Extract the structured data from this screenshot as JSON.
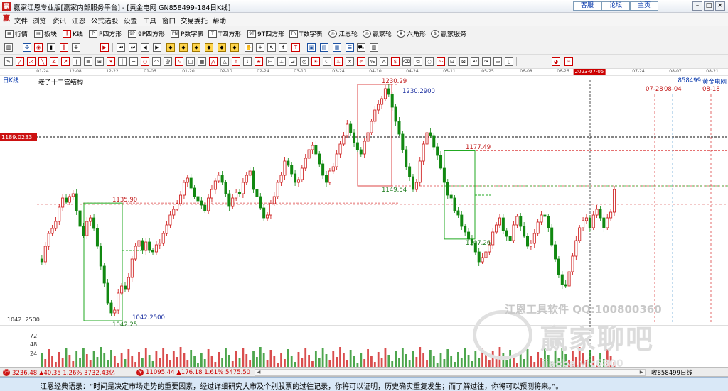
{
  "window": {
    "title": "赢家江恩专业版[赢家内部服务平台] - [黄金电网  GN858499-184日K线]",
    "links": [
      "客服",
      "论坛",
      "主页"
    ]
  },
  "menu": [
    "文件",
    "浏览",
    "资讯",
    "江恩",
    "公式选股",
    "设置",
    "工具",
    "窗口",
    "交易委托",
    "帮助"
  ],
  "toolbar1": [
    {
      "icon": "grid-icon",
      "label": "行情"
    },
    {
      "icon": "blocks-icon",
      "label": "板块"
    },
    {
      "icon": "candles-icon",
      "label": "K线"
    },
    {
      "icon": "p-square-icon",
      "label": "P四方形"
    },
    {
      "icon": "9p-square-icon",
      "label": "9P四方形"
    },
    {
      "icon": "pn-square-icon",
      "label": "P数字表"
    },
    {
      "icon": "t-square-icon",
      "label": "T四方形"
    },
    {
      "icon": "9t-square-icon",
      "label": "9T四方形"
    },
    {
      "icon": "tn-square-icon",
      "label": "T数字表"
    },
    {
      "icon": "gann-wheel-icon",
      "label": "江恩轮"
    },
    {
      "icon": "winner-wheel-icon",
      "label": "赢家轮"
    },
    {
      "icon": "hexagon-icon",
      "label": "六角形"
    },
    {
      "icon": "dollar-icon",
      "label": "赢家服务"
    }
  ],
  "timeline": {
    "labels": [
      "01-24",
      "12-08",
      "12-22",
      "01-06",
      "01-20",
      "02-10",
      "02-24",
      "03-10",
      "03-24",
      "04-10",
      "04-24",
      "05-11",
      "05-25",
      "06-08",
      "06-26",
      "2023-07-05",
      "07-24",
      "08-07",
      "08-21"
    ],
    "highlight": "2023-07-05"
  },
  "chart_header": {
    "period": "日K线",
    "study": "老子十二宫结构",
    "code": "858499",
    "name": "黄金电网"
  },
  "chart_labels": {
    "price_badge": "1189.0233",
    "low_axis": "1042. 2500",
    "vol_ticks": [
      "72",
      "48",
      "24"
    ],
    "forecast_dates": [
      "07-28",
      "08-04",
      "08-18"
    ]
  },
  "annotations": {
    "a1135": "1135.90",
    "a1042_green": "1042.25",
    "a1042_blue": "1042.2500",
    "a1230_red": "1230.29",
    "a1230_blue": "1230.2900",
    "a1149": "1149.54",
    "a1177": "1177.49",
    "a1107": "1107.26"
  },
  "watermark": {
    "line1": "江恩工具软件  QQ:100800360",
    "line2": "赢家聊吧",
    "line3": "jiaoba.vic6800"
  },
  "status": {
    "index1": "3236.48 ▲40.35 1.26% 3732.43亿",
    "index2": "11095.44 ▲176.18 1.61% 5475.50",
    "right": "收858499日线"
  },
  "quote": "江恩经典语录：“时间是决定市场走势的重要因素，经过详细研究大市及个别股票的过往记录，你将可以证明，历史确实重复发生；而了解过往，你将可以预测将来。”。",
  "chart_data": {
    "type": "candlestick",
    "ylabel": "",
    "price_range": [
      1030,
      1240
    ],
    "reference_levels": [
      1189.0233,
      1177.49,
      1149.54,
      1135.9,
      1107.26,
      1042.25
    ],
    "boxes": [
      {
        "from_price": 1135.9,
        "to_price": 1042.25
      },
      {
        "from_price": 1230.29,
        "to_price": 1149.54
      },
      {
        "from_price": 1177.49,
        "to_price": 1107.26
      }
    ],
    "volume_ticks": [
      72,
      48,
      24
    ],
    "colors": {
      "up": "#cc1111",
      "down": "#118811",
      "box_red": "#dd4444",
      "box_green": "#22aa22"
    }
  }
}
